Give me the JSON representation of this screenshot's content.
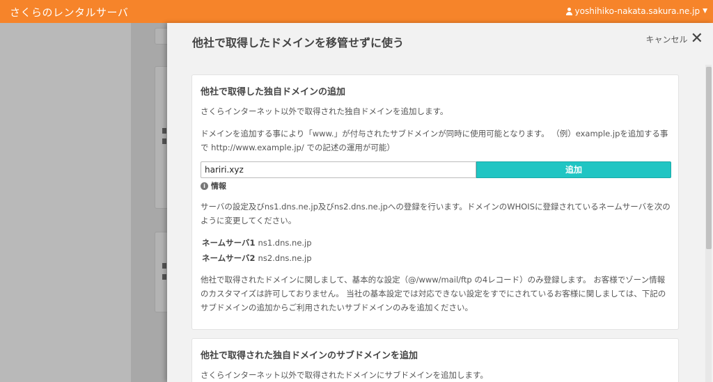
{
  "app": {
    "brand": "さくらのレンタルサーバ",
    "account": "yoshihiko-nakata.sakura.ne.jp"
  },
  "modal": {
    "title": "他社で取得したドメインを移管せずに使う",
    "cancel_label": "キャンセル"
  },
  "card1": {
    "title": "他社で取得した独自ドメインの追加",
    "desc1": "さくらインターネット以外で取得された独自ドメインを追加します。",
    "desc2": "ドメインを追加する事により「www.」が付与されたサブドメインが同時に使用可能となります。 （例）example.jpを追加する事で http://www.example.jp/ での記述の運用が可能）",
    "input_value": "hariri.xyz",
    "add_label": "追加",
    "info_label": "情報",
    "info_text": "サーバの設定及びns1.dns.ne.jp及びns2.dns.ne.jpへの登録を行います。ドメインのWHOISに登録されているネームサーバを次のように変更してください。",
    "nameservers": [
      {
        "label": "ネームサーバ1",
        "value": "ns1.dns.ne.jp"
      },
      {
        "label": "ネームサーバ2",
        "value": "ns2.dns.ne.jp"
      }
    ],
    "note": "他社で取得されたドメインに関しまして、基本的な設定（@/www/mail/ftp の4レコード）のみ登録します。 お客様でゾーン情報のカスタマイズは許可しておりません。 当社の基本設定では対応できない設定をすでにされているお客様に関しましては、下記のサブドメインの追加からご利用されたいサブドメインのみを追加ください。"
  },
  "card2": {
    "title": "他社で取得された独自ドメインのサブドメインを追加",
    "desc1": "さくらインターネット以外で取得されたドメインにサブドメインを追加します。"
  },
  "colors": {
    "topbar": "#f6842a",
    "add_button": "#20c5c3"
  },
  "icons": [
    "user-icon",
    "chevron-down-icon",
    "close-icon",
    "info-icon"
  ]
}
